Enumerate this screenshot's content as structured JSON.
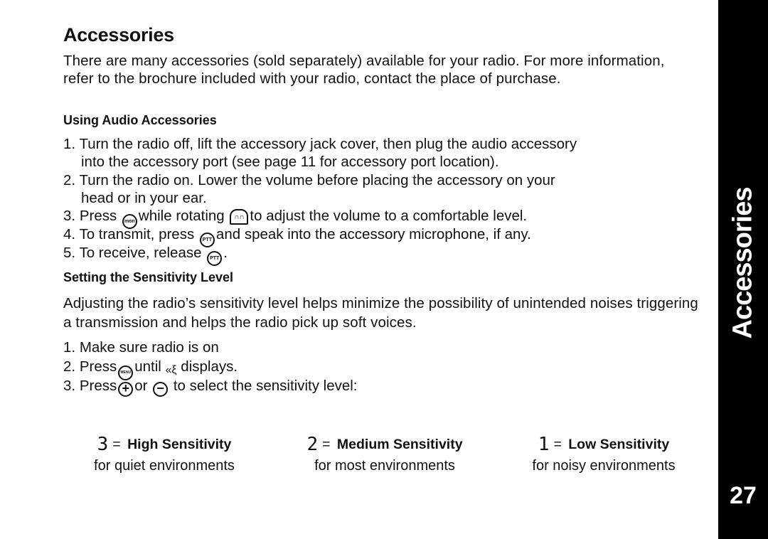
{
  "page": {
    "title": "Accessories",
    "intro": "There are many accessories (sold separately) available for your radio. For more information, refer to the brochure included with your radio, contact the place of purchase.",
    "section_tab": "Accessories",
    "page_number": "27"
  },
  "audio": {
    "heading": "Using Audio Accessories",
    "steps": [
      {
        "num": "1.",
        "line1": "Turn the radio off, lift the accessory jack cover, then plug the audio accessory",
        "line2": "into the accessory port (see page 11 for accessory port location)."
      },
      {
        "num": "2.",
        "line1": "Turn the radio on. Lower the volume before placing the accessory on your",
        "line2": "head or in your ear."
      },
      {
        "num": "3.",
        "pre": "Press",
        "mid": "while rotating",
        "post": "to adjust the volume to a comfortable level."
      },
      {
        "num": "4.",
        "pre": "To transmit, press",
        "post": "and speak into the accessory microphone, if any."
      },
      {
        "num": "5.",
        "pre": "To receive, release",
        "post": "."
      }
    ]
  },
  "sensitivity": {
    "heading": "Setting the Sensitivity Level",
    "intro": "Adjusting the radio’s sensitivity level helps minimize the possibility of unintended noises triggering a transmission and helps the radio pick up soft voices.",
    "steps": [
      {
        "num": "1.",
        "text": "Make sure radio is on"
      },
      {
        "num": "2.",
        "pre": "Press",
        "mid": "until",
        "post": "displays."
      },
      {
        "num": "3.",
        "pre": "Press",
        "mid": "or",
        "post": "to select the sensitivity level:"
      }
    ],
    "levels": [
      {
        "digit": "3",
        "eq": "=",
        "label": "High Sensitivity",
        "desc": "for quiet environments"
      },
      {
        "digit": "2",
        "eq": "=",
        "label": "Medium Sensitivity",
        "desc": "for most environments"
      },
      {
        "digit": "1",
        "eq": "=",
        "label": "Low Sensitivity",
        "desc": "for noisy environments"
      }
    ]
  },
  "icons": {
    "mon": "mon",
    "ptt": "PTT",
    "menu": "MENU",
    "plus": "+",
    "minus": "−",
    "knob": "∩∩",
    "vox": "«ξ"
  }
}
